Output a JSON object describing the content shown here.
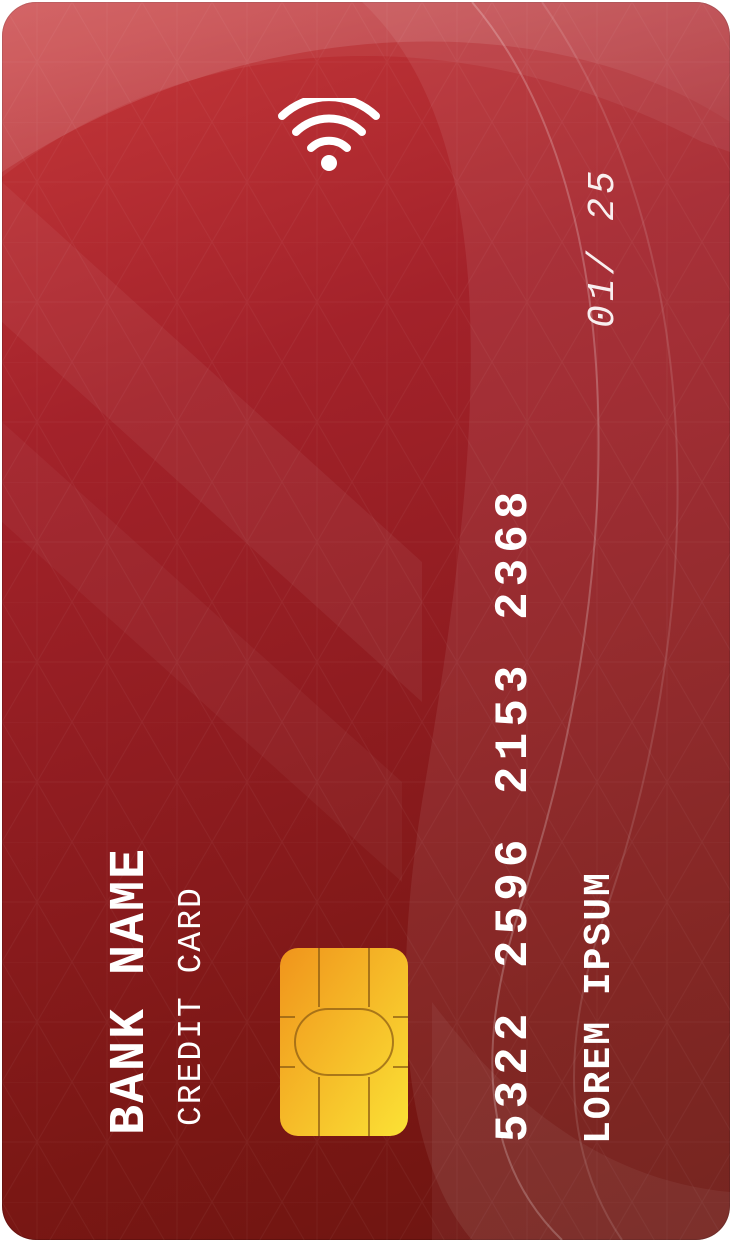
{
  "card": {
    "bank_name": "BANK NAME",
    "card_type": "CREDIT CARD",
    "card_number": "5322 2596 2153 2368",
    "holder_name": "LOREM IPSUM",
    "expiry": "01/ 25"
  },
  "icons": {
    "contactless": "contactless-icon",
    "chip": "chip-icon"
  },
  "colors": {
    "card_base": "#a3222a",
    "card_dark": "#6b1510",
    "text": "#ffffff",
    "chip_light": "#f9d436",
    "chip_dark": "#f0941c"
  }
}
